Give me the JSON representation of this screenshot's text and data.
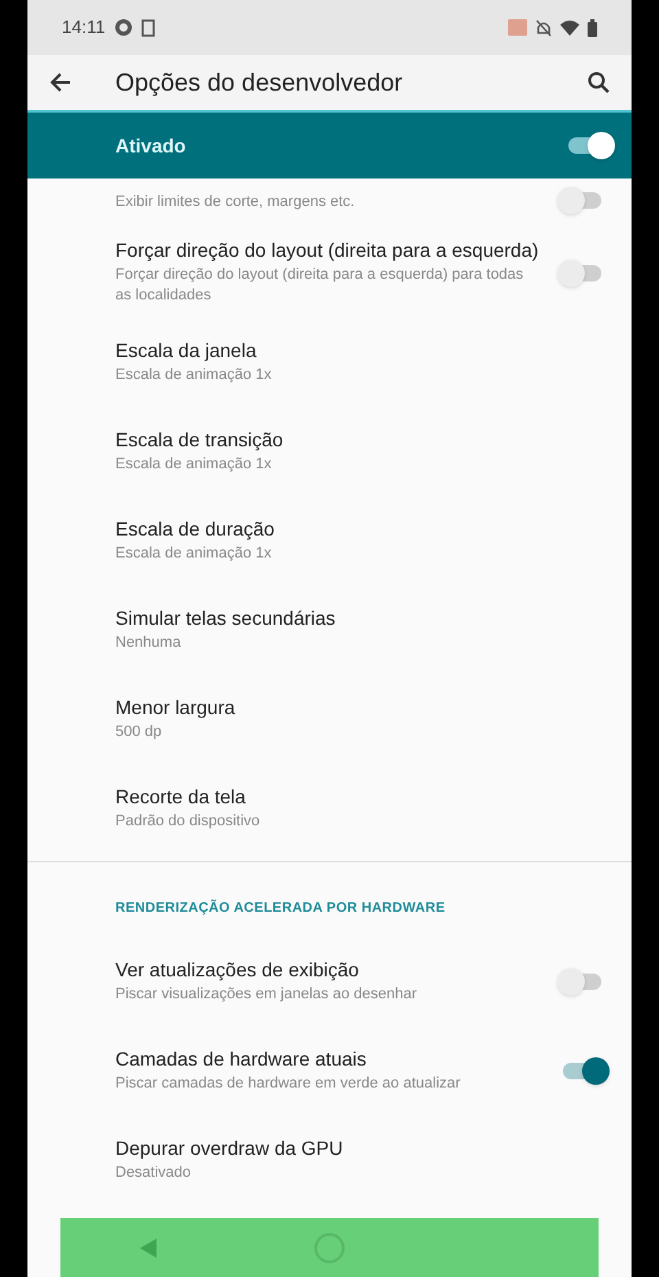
{
  "status_bar": {
    "time": "14:11"
  },
  "app_bar": {
    "title": "Opções do desenvolvedor"
  },
  "master_switch": {
    "label": "Ativado",
    "on": true
  },
  "settings": [
    {
      "kind": "switch",
      "summary": "Exibir limites de corte, margens etc.",
      "on": false
    },
    {
      "kind": "switch",
      "title": "Forçar direção do layout (direita para a esquerda)",
      "summary": "Forçar direção do layout (direita para a esquerda) para todas as localidades",
      "on": false
    },
    {
      "kind": "value",
      "title": "Escala da janela",
      "summary": "Escala de animação 1x"
    },
    {
      "kind": "value",
      "title": "Escala de transição",
      "summary": "Escala de animação 1x"
    },
    {
      "kind": "value",
      "title": "Escala de duração",
      "summary": "Escala de animação 1x"
    },
    {
      "kind": "value",
      "title": "Simular telas secundárias",
      "summary": "Nenhuma"
    },
    {
      "kind": "value",
      "title": "Menor largura",
      "summary": "500 dp"
    },
    {
      "kind": "value",
      "title": "Recorte da tela",
      "summary": "Padrão do dispositivo"
    },
    {
      "kind": "divider"
    },
    {
      "kind": "header",
      "title": "RENDERIZAÇÃO ACELERADA POR HARDWARE"
    },
    {
      "kind": "switch",
      "title": "Ver atualizações de exibição",
      "summary": "Piscar visualizações em janelas ao desenhar",
      "on": false
    },
    {
      "kind": "switch",
      "title": "Camadas de hardware atuais",
      "summary": "Piscar camadas de hardware em verde ao atualizar",
      "on": true
    },
    {
      "kind": "value",
      "title": "Depurar overdraw da GPU",
      "summary": "Desativado"
    }
  ]
}
